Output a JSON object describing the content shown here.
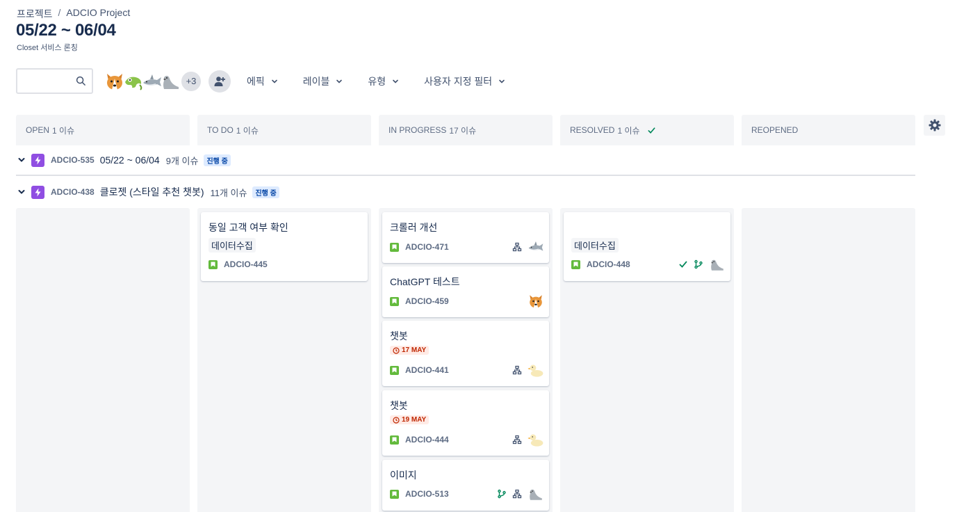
{
  "breadcrumb": {
    "project": "프로젝트",
    "separator": "/",
    "current": "ADCIO Project"
  },
  "page": {
    "title": "05/22 ~ 06/04",
    "subtitle": "Closet 서비스 론칭"
  },
  "toolbar": {
    "search_placeholder": "",
    "avatars": [
      "corgi-avatar",
      "chameleon-avatar",
      "shark-avatar",
      "seal-avatar"
    ],
    "more_avatars": "+3",
    "filters": [
      "에픽",
      "레이블",
      "유형",
      "사용자 지정 필터"
    ]
  },
  "columns": [
    {
      "name": "OPEN",
      "count": "1 이슈",
      "done": false
    },
    {
      "name": "TO DO",
      "count": "1 이슈",
      "done": false
    },
    {
      "name": "IN PROGRESS",
      "count": "17 이슈",
      "done": false
    },
    {
      "name": "RESOLVED",
      "count": "1 이슈",
      "done": true
    },
    {
      "name": "REOPENED",
      "count": "",
      "done": false
    }
  ],
  "swimlanes": [
    {
      "key": "ADCIO-535",
      "name": "05/22 ~ 06/04",
      "count": "9개 이슈",
      "status": "진행 중"
    },
    {
      "key": "ADCIO-438",
      "name": "클로젯 (스타일 추천 챗봇)",
      "count": "11개 이슈",
      "status": "진행 중"
    }
  ],
  "cards": {
    "todo": [
      {
        "summary": "동일 고객 여부 확인",
        "label": "데이터수집",
        "key": "ADCIO-445"
      }
    ],
    "in_progress": [
      {
        "summary": "크롤러 개선",
        "key": "ADCIO-471",
        "avatar": "shark-avatar"
      },
      {
        "summary": "ChatGPT 테스트",
        "key": "ADCIO-459",
        "avatar": "corgi-avatar"
      },
      {
        "summary": "챗봇",
        "due": "17 MAY",
        "key": "ADCIO-441",
        "avatar": "duck-avatar"
      },
      {
        "summary": "챗봇",
        "due": "19 MAY",
        "key": "ADCIO-444",
        "avatar": "duck-avatar"
      },
      {
        "summary": "이미지",
        "key": "ADCIO-513",
        "avatar": "seal-avatar"
      }
    ],
    "resolved": [
      {
        "label": "데이터수집",
        "key": "ADCIO-448",
        "avatar": "seal-avatar"
      }
    ]
  },
  "colors": {
    "epic": "#904ee2",
    "story": "#63ba3c",
    "status_bg": "#deebff",
    "due_bg": "#ffebe6",
    "success": "#00875a"
  }
}
